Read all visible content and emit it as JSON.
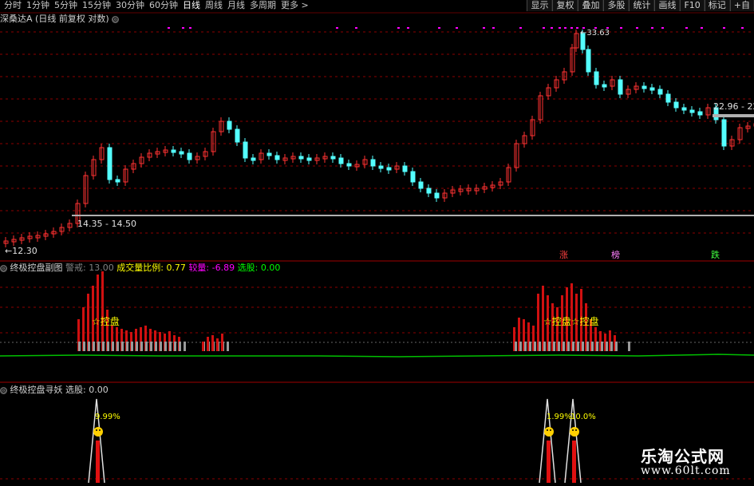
{
  "toolbar": {
    "periods": [
      "分时",
      "1分钟",
      "5分钟",
      "15分钟",
      "30分钟",
      "60分钟",
      "日线",
      "周线",
      "月线",
      "多周期",
      "更多 >"
    ],
    "active_period": "日线",
    "right_buttons": [
      "显示",
      "复权",
      "叠加",
      "多股",
      "统计",
      "画线",
      "F10",
      "标记",
      "+自"
    ]
  },
  "main_panel": {
    "title": "深桑达A",
    "subtitle": "(日线 前复权 对数)",
    "price_labels": {
      "high": "33.63",
      "range_left": "14.35 - 14.50",
      "low": "12.30",
      "range_right": "22.96 - 22"
    },
    "events": [
      "涨",
      "榜",
      "跌"
    ]
  },
  "sub_panel_1": {
    "title": "终极控盘副图",
    "warn_label": "警戒:",
    "warn_value": "13.00",
    "ratio_label": "成交量比例:",
    "ratio_value": "0.77",
    "diff_label": "较量:",
    "diff_value": "-6.89",
    "pick_label": "选股:",
    "pick_value": "0.00",
    "annotations": [
      "☆控盘",
      "☆控盘☆控盘"
    ]
  },
  "sub_panel_2": {
    "title": "终极控盘寻妖",
    "pick_label": "选股:",
    "pick_value": "0.00",
    "annotations": [
      "9.99%",
      "1.99%",
      "10.0%"
    ]
  },
  "watermark": {
    "line1": "乐淘公式网",
    "line2": "www.60lt.com"
  },
  "colors": {
    "up": "#ff3232",
    "down": "#54ffff",
    "yellow": "#ffff00",
    "magenta": "#ff00ff",
    "green": "#00ff00",
    "grid": "#8b0000"
  }
}
